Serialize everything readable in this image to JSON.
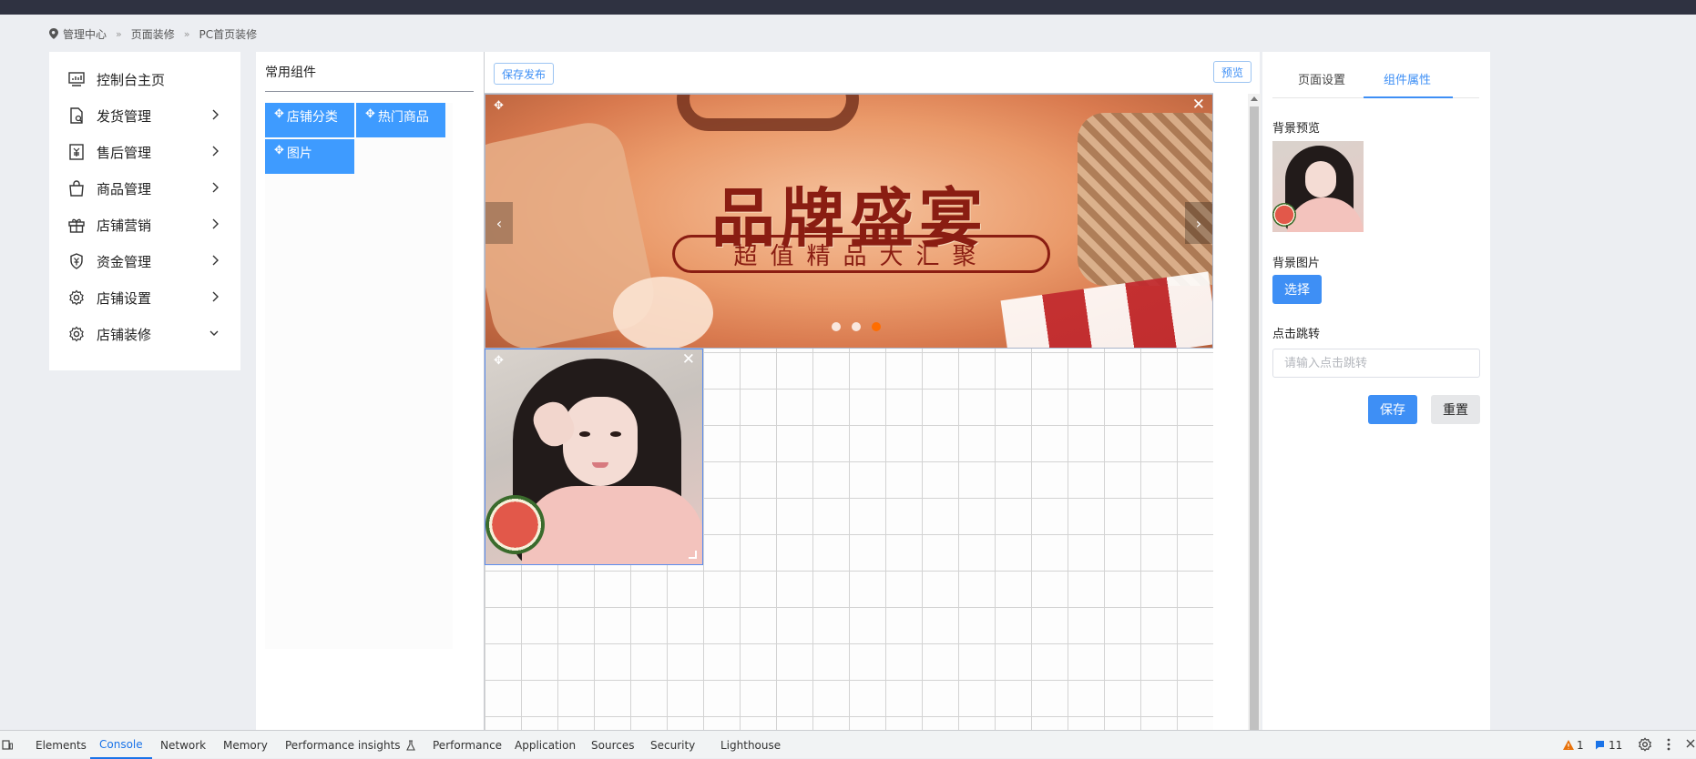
{
  "breadcrumb": {
    "items": [
      "管理中心",
      "页面装修",
      "PC首页装修"
    ],
    "separator": "»"
  },
  "sidebar": {
    "items": [
      {
        "label": "控制台主页",
        "icon": "dashboard-icon",
        "chevron": "none"
      },
      {
        "label": "发货管理",
        "icon": "shipping-icon",
        "chevron": "right"
      },
      {
        "label": "售后管理",
        "icon": "after-sales-icon",
        "chevron": "right"
      },
      {
        "label": "商品管理",
        "icon": "shopping-bag-icon",
        "chevron": "right"
      },
      {
        "label": "店铺营销",
        "icon": "gift-icon",
        "chevron": "right"
      },
      {
        "label": "资金管理",
        "icon": "money-shield-icon",
        "chevron": "right"
      },
      {
        "label": "店铺设置",
        "icon": "gear-icon",
        "chevron": "right"
      },
      {
        "label": "店铺装修",
        "icon": "gear-icon",
        "chevron": "down"
      }
    ]
  },
  "components": {
    "title": "常用组件",
    "items": [
      "店铺分类",
      "热门商品",
      "图片"
    ],
    "move_glyph": "✥"
  },
  "canvas": {
    "save_publish_label": "保存发布",
    "preview_label": "预览",
    "banner": {
      "title": "品牌盛宴",
      "subtitle": "超值精品大汇聚",
      "prev_glyph": "‹",
      "next_glyph": "›",
      "slide_count": 3,
      "active_slide": 3
    },
    "close_glyph": "✕",
    "move_glyph": "✥"
  },
  "properties": {
    "tabs": [
      "页面设置",
      "组件属性"
    ],
    "active_tab": 1,
    "bg_preview_label": "背景预览",
    "bg_image_label": "背景图片",
    "choose_label": "选择",
    "click_jump_label": "点击跳转",
    "click_jump_placeholder": "请输入点击跳转",
    "click_jump_value": "",
    "save_label": "保存",
    "reset_label": "重置"
  },
  "devtools": {
    "tabs": [
      "Elements",
      "Console",
      "Network",
      "Memory",
      "Performance insights",
      "Performance",
      "Application",
      "Sources",
      "Security",
      "Lighthouse"
    ],
    "active_tab": "Console",
    "warnings_count": "1",
    "messages_count": "11"
  },
  "colors": {
    "accent": "#3e8ff5",
    "component_button": "#3e9bff",
    "topbar": "#2f3241",
    "page_bg": "#eceef2",
    "banner_text": "#8a1d12",
    "active_dot": "#ff6d00"
  }
}
